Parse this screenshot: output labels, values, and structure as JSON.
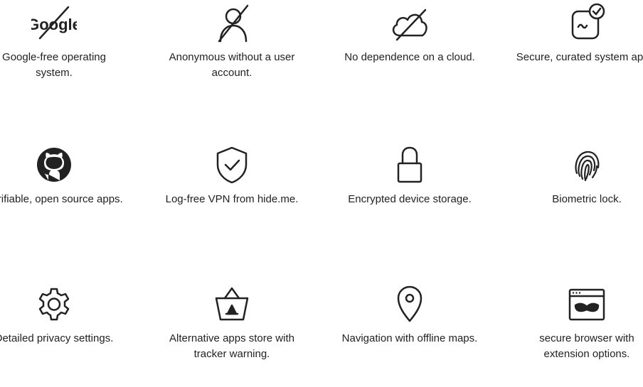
{
  "features": [
    {
      "icon": "google-crossed-icon",
      "label": "Google-free operating system."
    },
    {
      "icon": "anonymous-user-icon",
      "label": "Anonymous without a user account."
    },
    {
      "icon": "no-cloud-icon",
      "label": "No dependence on a cloud."
    },
    {
      "icon": "verified-app-icon",
      "label": "Secure, curated system apps."
    },
    {
      "icon": "github-icon",
      "label": "Verifiable, open source apps."
    },
    {
      "icon": "shield-check-icon",
      "label": "Log-free VPN from hide.me."
    },
    {
      "icon": "lock-icon",
      "label": "Encrypted device storage."
    },
    {
      "icon": "fingerprint-icon",
      "label": "Biometric lock."
    },
    {
      "icon": "gear-icon",
      "label": "Detailed privacy settings."
    },
    {
      "icon": "app-store-basket-icon",
      "label": "Alternative apps store with tracker warning."
    },
    {
      "icon": "map-pin-icon",
      "label": "Navigation with offline maps."
    },
    {
      "icon": "browser-mask-icon",
      "label": "secure browser with extension options."
    }
  ],
  "logo_text": "Google"
}
